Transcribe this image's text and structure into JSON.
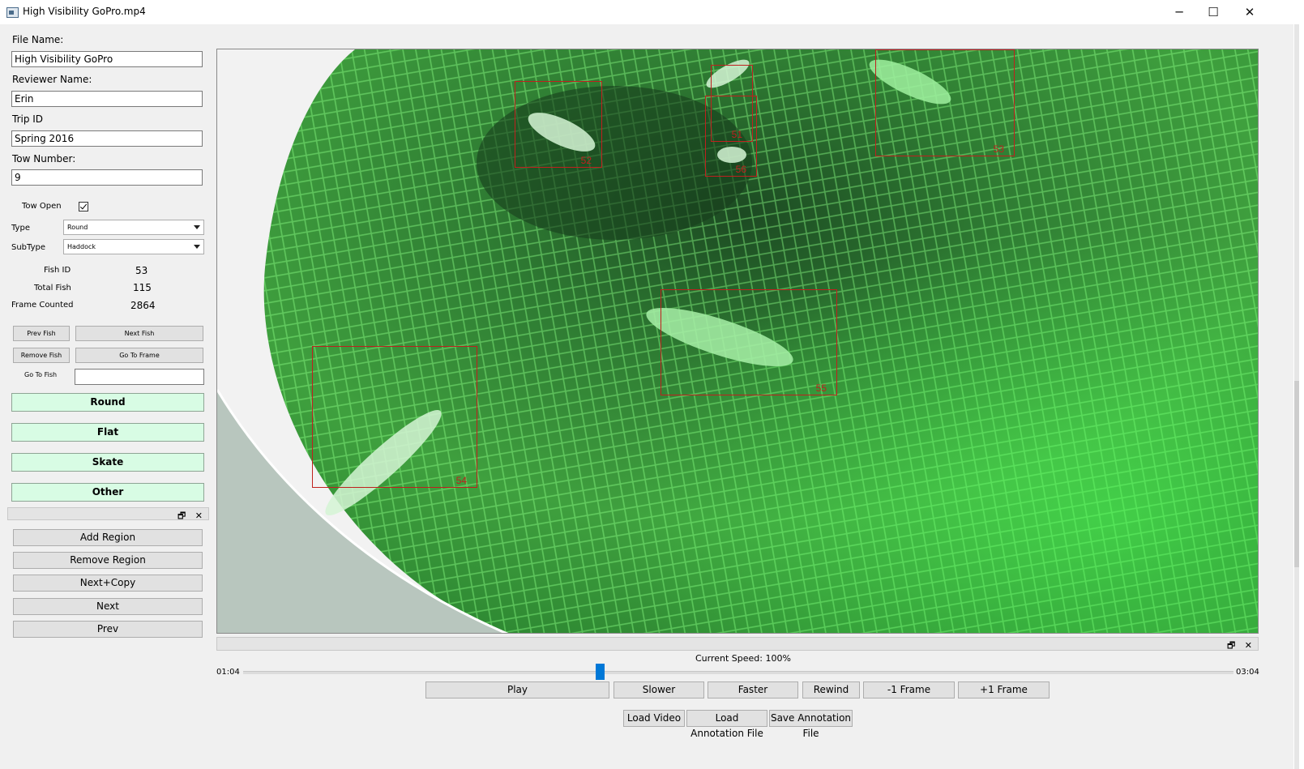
{
  "window": {
    "title": "High Visibility GoPro.mp4",
    "minimize_glyph": "─",
    "maximize_glyph": "☐",
    "close_glyph": "✕"
  },
  "form": {
    "file_name_label": "File Name:",
    "file_name_value": "High Visibility GoPro",
    "reviewer_label": "Reviewer Name:",
    "reviewer_value": "Erin",
    "trip_label": "Trip ID",
    "trip_value": "Spring 2016",
    "tow_label": "Tow Number:",
    "tow_value": "9",
    "tow_open_label": "Tow Open",
    "tow_open_checked": true,
    "type_label": "Type",
    "type_value": "Round",
    "subtype_label": "SubType",
    "subtype_value": "Haddock",
    "fish_id_label": "Fish ID",
    "fish_id_value": "53",
    "total_fish_label": "Total Fish",
    "total_fish_value": "115",
    "frame_counted_label": "Frame Counted",
    "frame_counted_value": "2864",
    "prev_fish": "Prev Fish",
    "next_fish": "Next Fish",
    "remove_fish": "Remove Fish",
    "go_to_frame": "Go To Frame",
    "go_to_fish_label": "Go To Fish",
    "go_to_fish_value": ""
  },
  "categories": [
    "Round",
    "Flat",
    "Skate",
    "Other"
  ],
  "region_tools": {
    "dock_glyphs": "🗗 ✕",
    "buttons": [
      "Add Region",
      "Remove Region",
      "Next+Copy",
      "Next",
      "Prev"
    ]
  },
  "video": {
    "annotations": [
      "52",
      "51",
      "56",
      "53",
      "55",
      "54"
    ],
    "box_color": "#c0201e"
  },
  "playback": {
    "dock_glyphs": "🗗 ✕",
    "speed_text": "Current Speed: 100%",
    "current_time": "01:04",
    "total_time": "03:04",
    "position_fraction": 0.36,
    "play": "Play",
    "slower": "Slower",
    "faster": "Faster",
    "rewind": "Rewind",
    "minus_frame": "-1 Frame",
    "plus_frame": "+1 Frame",
    "load_video": "Load Video",
    "load_annotation": "Load Annotation File",
    "save_annotation": "Save Annotation File"
  }
}
